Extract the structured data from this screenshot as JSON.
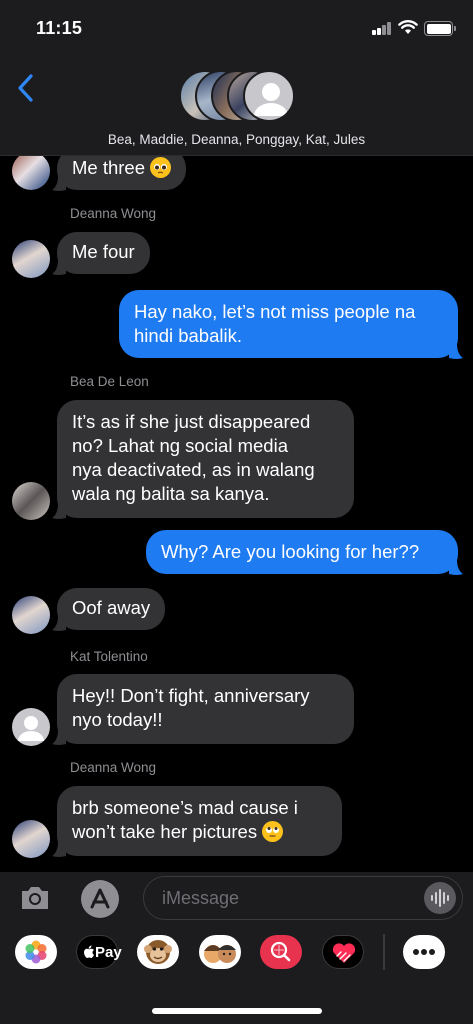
{
  "status_bar": {
    "time": "11:15"
  },
  "header": {
    "group_names": "Bea, Maddie, Deanna, Ponggay, Kat, Jules"
  },
  "messages": [
    {
      "type": "in",
      "text": "Me three"
    },
    {
      "sender": "Deanna Wong"
    },
    {
      "type": "in",
      "text": "Me four"
    },
    {
      "type": "out",
      "text_line1": "Hay nako, let’s not miss people na",
      "text_line2": "hindi babalik."
    },
    {
      "sender": "Bea De Leon"
    },
    {
      "type": "in",
      "lines": [
        "It’s as if she just disappeared",
        "no? Lahat ng social media",
        "nya deactivated, as in walang",
        "wala ng balita sa kanya."
      ]
    },
    {
      "type": "out",
      "text": "Why? Are you looking for her??"
    },
    {
      "type": "in",
      "text": "Oof away"
    },
    {
      "sender": "Kat Tolentino"
    },
    {
      "type": "in",
      "lines": [
        "Hey!! Don’t fight, anniversary",
        "nyo today!!"
      ]
    },
    {
      "sender": "Deanna Wong"
    },
    {
      "type": "in",
      "lines": [
        "brb someone’s mad cause i",
        "won’t take her pictures"
      ]
    }
  ],
  "compose": {
    "placeholder": "iMessage"
  },
  "app_drawer": {
    "apple_pay_label": "Pay"
  },
  "colors": {
    "outgoing": "#1f7bf2",
    "incoming": "#333335",
    "background": "#000000"
  }
}
